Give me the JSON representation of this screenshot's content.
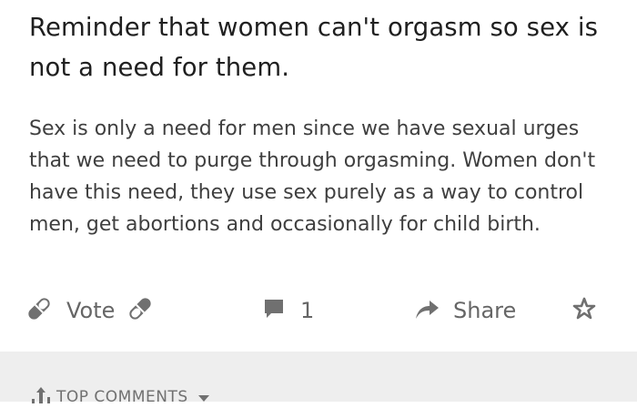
{
  "post": {
    "title": "Reminder that women can't orgasm so sex is not a need for them.",
    "body": "Sex is only a need for men since we have sexual urges that we need to purge through orgasming. Women don't have this need, they use sex purely as a way to control men, get abortions and occasionally for child birth."
  },
  "actions": {
    "vote_label": "Vote",
    "comment_count": "1",
    "share_label": "Share"
  },
  "comments_header": {
    "sort_label": "TOP COMMENTS"
  },
  "icons": {
    "upvote": "pill-upvote-icon",
    "downvote": "pill-downvote-icon",
    "comment": "comment-bubble-icon",
    "share": "share-arrow-icon",
    "save": "star-outline-icon",
    "sort": "sort-arrow-icon",
    "sort_caret": "caret-down-icon"
  },
  "colors": {
    "text_primary": "#1f1f1f",
    "text_body": "#3f3f3f",
    "icon_gray": "#707070",
    "footer_bg": "#eeeeee"
  }
}
